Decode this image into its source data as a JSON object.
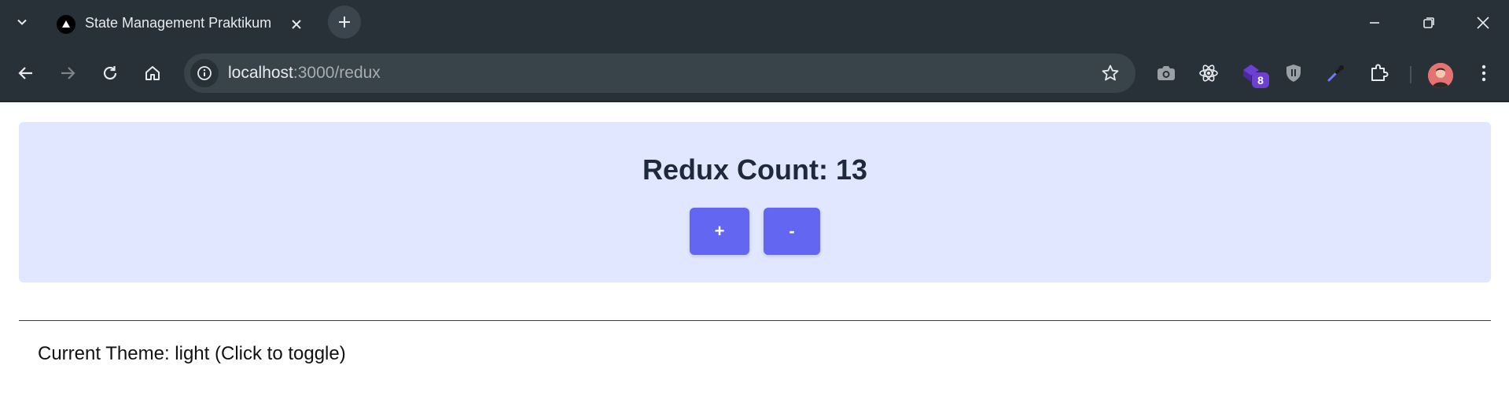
{
  "browser": {
    "tab_title": "State Management Praktikum",
    "url_host": "localhost",
    "url_path": ":3000/redux",
    "extension_badge": "8"
  },
  "page": {
    "counter_title": "Redux Count: 13",
    "increment_label": "+",
    "decrement_label": "-",
    "theme_text": "Current Theme: light (Click to toggle)"
  },
  "colors": {
    "chrome_bg": "#283138",
    "card_bg": "#e0e7ff",
    "button_bg": "#6366f1"
  }
}
